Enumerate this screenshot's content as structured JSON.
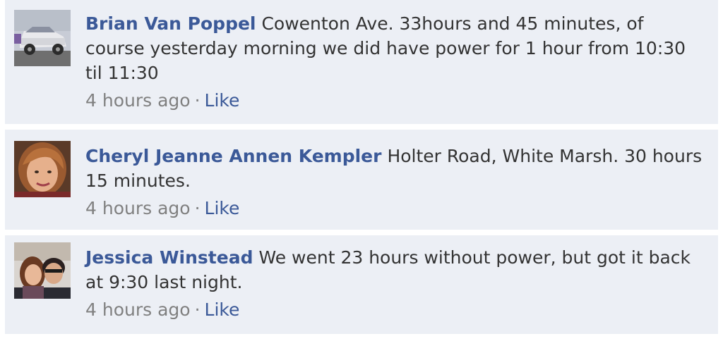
{
  "comments": [
    {
      "author": "Brian Van Poppel",
      "text": "Cowenton Ave. 33hours and 45 minutes, of course yesterday morning we did have power for 1 hour from 10:30 til 11:30",
      "timestamp": "4 hours ago",
      "separator": "·",
      "like_label": "Like",
      "avatar_icon": "car-photo-avatar"
    },
    {
      "author": "Cheryl Jeanne Annen Kempler",
      "text": "Holter Road, White Marsh. 30 hours 15 minutes.",
      "timestamp": "4 hours ago",
      "separator": "·",
      "like_label": "Like",
      "avatar_icon": "woman-portrait-avatar"
    },
    {
      "author": "Jessica Winstead",
      "text": "We went 23 hours without power, but got it back at 9:30 last night.",
      "timestamp": "4 hours ago",
      "separator": "·",
      "like_label": "Like",
      "avatar_icon": "couple-photo-avatar"
    }
  ],
  "colors": {
    "comment_bg": "#eceff5",
    "link": "#3b5998",
    "text": "#333333",
    "meta": "#808080"
  }
}
